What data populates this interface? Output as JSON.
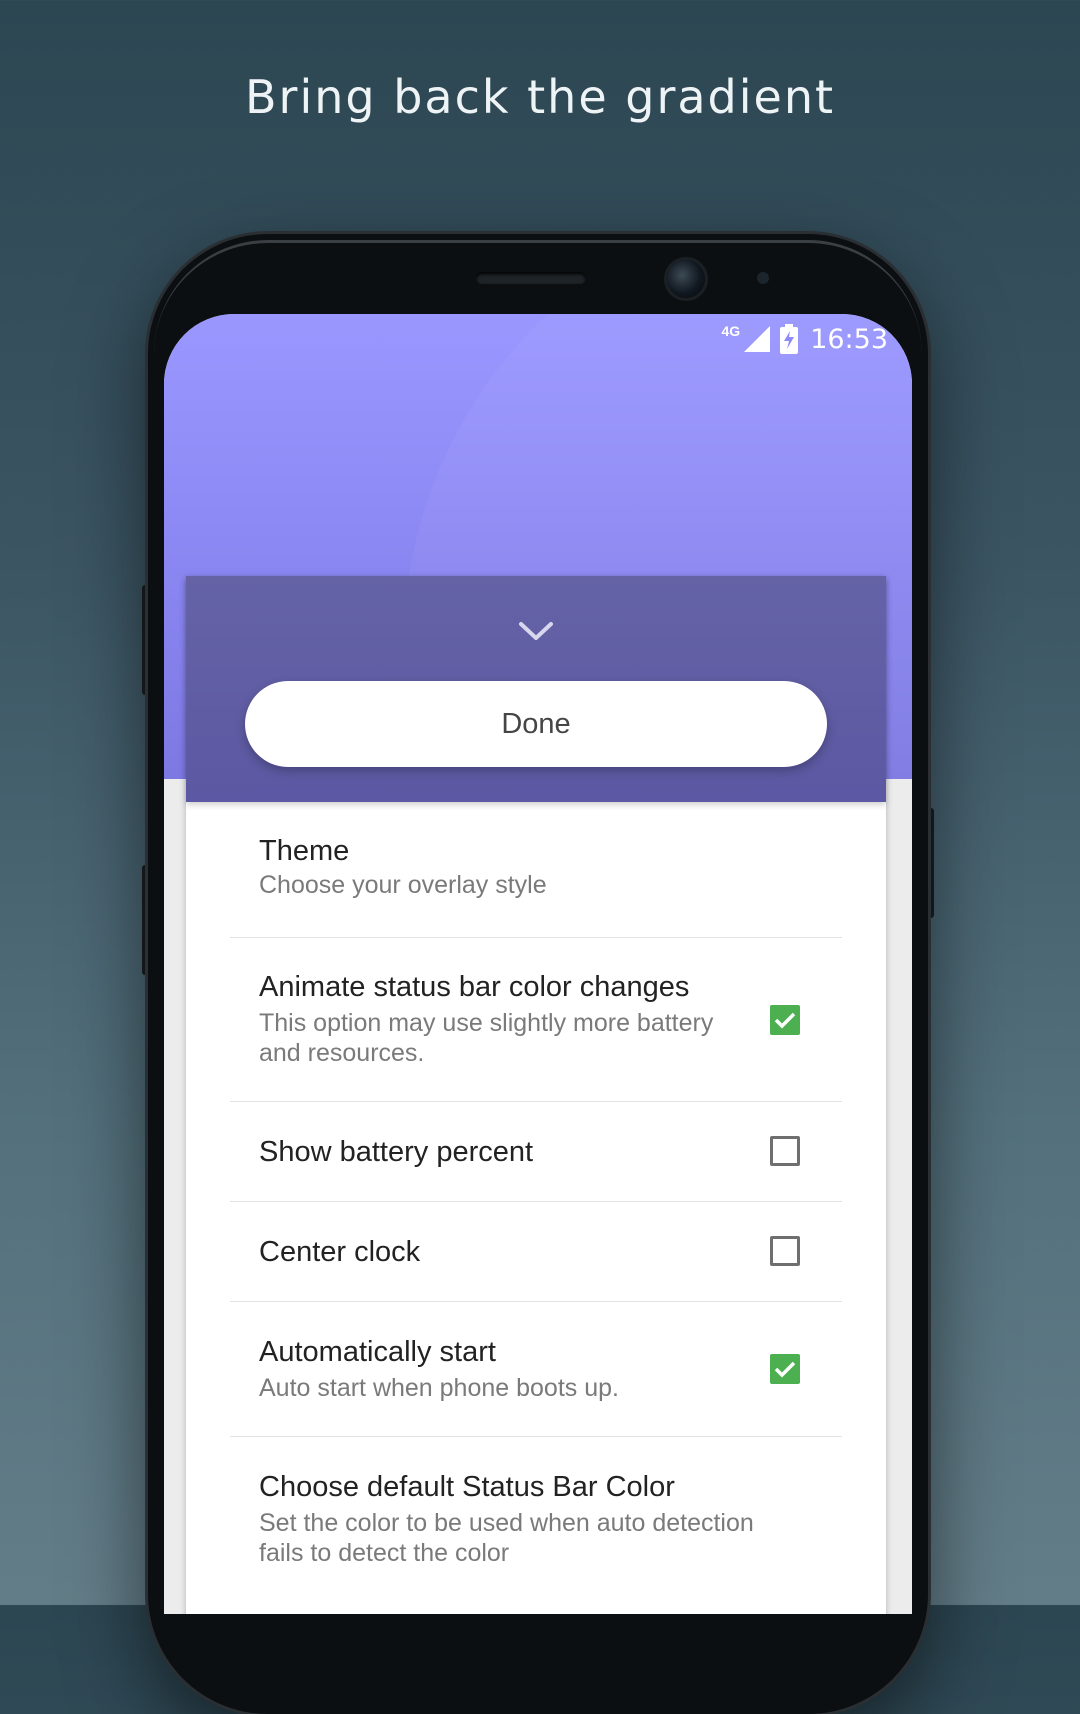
{
  "headline": "Bring back the gradient",
  "status_bar": {
    "network": "4G",
    "time": "16:53"
  },
  "sheet": {
    "done_label": "Done"
  },
  "settings": [
    {
      "title": "Theme",
      "subtitle": "Choose your overlay style",
      "checkbox": null
    },
    {
      "title": "Animate status bar color changes",
      "subtitle": "This option may use slightly more battery and resources.",
      "checkbox": true
    },
    {
      "title": "Show battery percent",
      "subtitle": "",
      "checkbox": false
    },
    {
      "title": "Center clock",
      "subtitle": "",
      "checkbox": false
    },
    {
      "title": "Automatically start",
      "subtitle": "Auto start when phone boots up.",
      "checkbox": true
    },
    {
      "title": "Choose default Status Bar Color",
      "subtitle": "Set the color to be used when auto detection fails to detect the color",
      "checkbox": null
    }
  ],
  "colors": {
    "accent": "#9a97ff",
    "sheet_header": "#5f5ba5",
    "checked": "#4caf50"
  },
  "icons": [
    "chevron-down-icon",
    "signal-icon",
    "battery-charging-icon",
    "check-icon"
  ]
}
